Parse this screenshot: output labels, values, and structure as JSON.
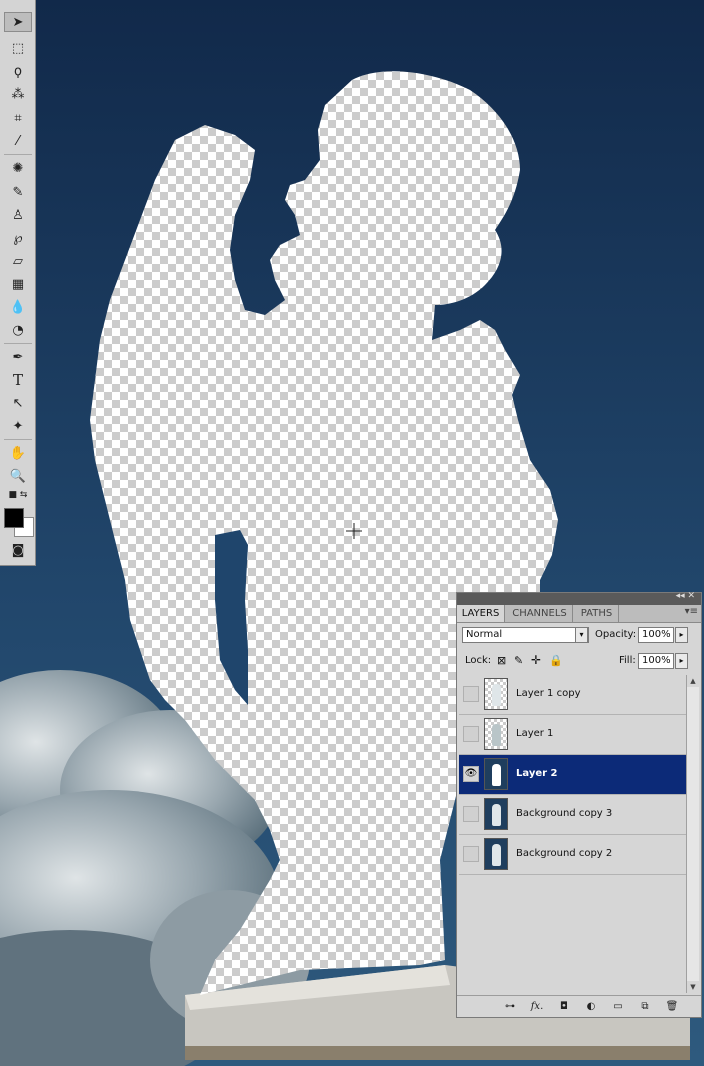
{
  "toolbox": {
    "tools": [
      {
        "name": "move-tool-icon",
        "glyph": "➤"
      },
      {
        "name": "marquee-tool-icon",
        "glyph": "⬚"
      },
      {
        "name": "lasso-tool-icon",
        "glyph": "ϙ"
      },
      {
        "name": "magic-wand-tool-icon",
        "glyph": "⁂"
      },
      {
        "name": "crop-tool-icon",
        "glyph": "⌗"
      },
      {
        "name": "eyedropper-tool-icon",
        "glyph": "⁄"
      },
      {
        "name": "spot-healing-tool-icon",
        "glyph": "✺"
      },
      {
        "name": "brush-tool-icon",
        "glyph": "✎"
      },
      {
        "name": "clone-stamp-tool-icon",
        "glyph": "♙"
      },
      {
        "name": "history-brush-tool-icon",
        "glyph": "℘"
      },
      {
        "name": "eraser-tool-icon",
        "glyph": "▱"
      },
      {
        "name": "gradient-tool-icon",
        "glyph": "▦"
      },
      {
        "name": "blur-tool-icon",
        "glyph": "💧"
      },
      {
        "name": "dodge-tool-icon",
        "glyph": "◔"
      },
      {
        "name": "pen-tool-icon",
        "glyph": "✒"
      },
      {
        "name": "type-tool-icon",
        "glyph": "T"
      },
      {
        "name": "path-selection-tool-icon",
        "glyph": "↖"
      },
      {
        "name": "shape-tool-icon",
        "glyph": "✦"
      },
      {
        "name": "hand-tool-icon",
        "glyph": "✋"
      },
      {
        "name": "zoom-tool-icon",
        "glyph": "🔍"
      },
      {
        "name": "quick-mask-icon",
        "glyph": "◙"
      }
    ]
  },
  "layers_panel": {
    "tabs": [
      {
        "label": "LAYERS",
        "active": true
      },
      {
        "label": "CHANNELS",
        "active": false
      },
      {
        "label": "PATHS",
        "active": false
      }
    ],
    "blend_mode": "Normal",
    "opacity_label": "Opacity:",
    "opacity_value": "100%",
    "lock_label": "Lock:",
    "fill_label": "Fill:",
    "fill_value": "100%",
    "layers": [
      {
        "name": "Layer 1 copy",
        "visible": false,
        "selected": false,
        "thumb": "trans"
      },
      {
        "name": "Layer 1",
        "visible": false,
        "selected": false,
        "thumb": "trans"
      },
      {
        "name": "Layer 2",
        "visible": true,
        "selected": true,
        "thumb": "trans"
      },
      {
        "name": "Background copy 3",
        "visible": false,
        "selected": false,
        "thumb": "dark"
      },
      {
        "name": "Background copy 2",
        "visible": false,
        "selected": false,
        "thumb": "dark"
      }
    ]
  }
}
